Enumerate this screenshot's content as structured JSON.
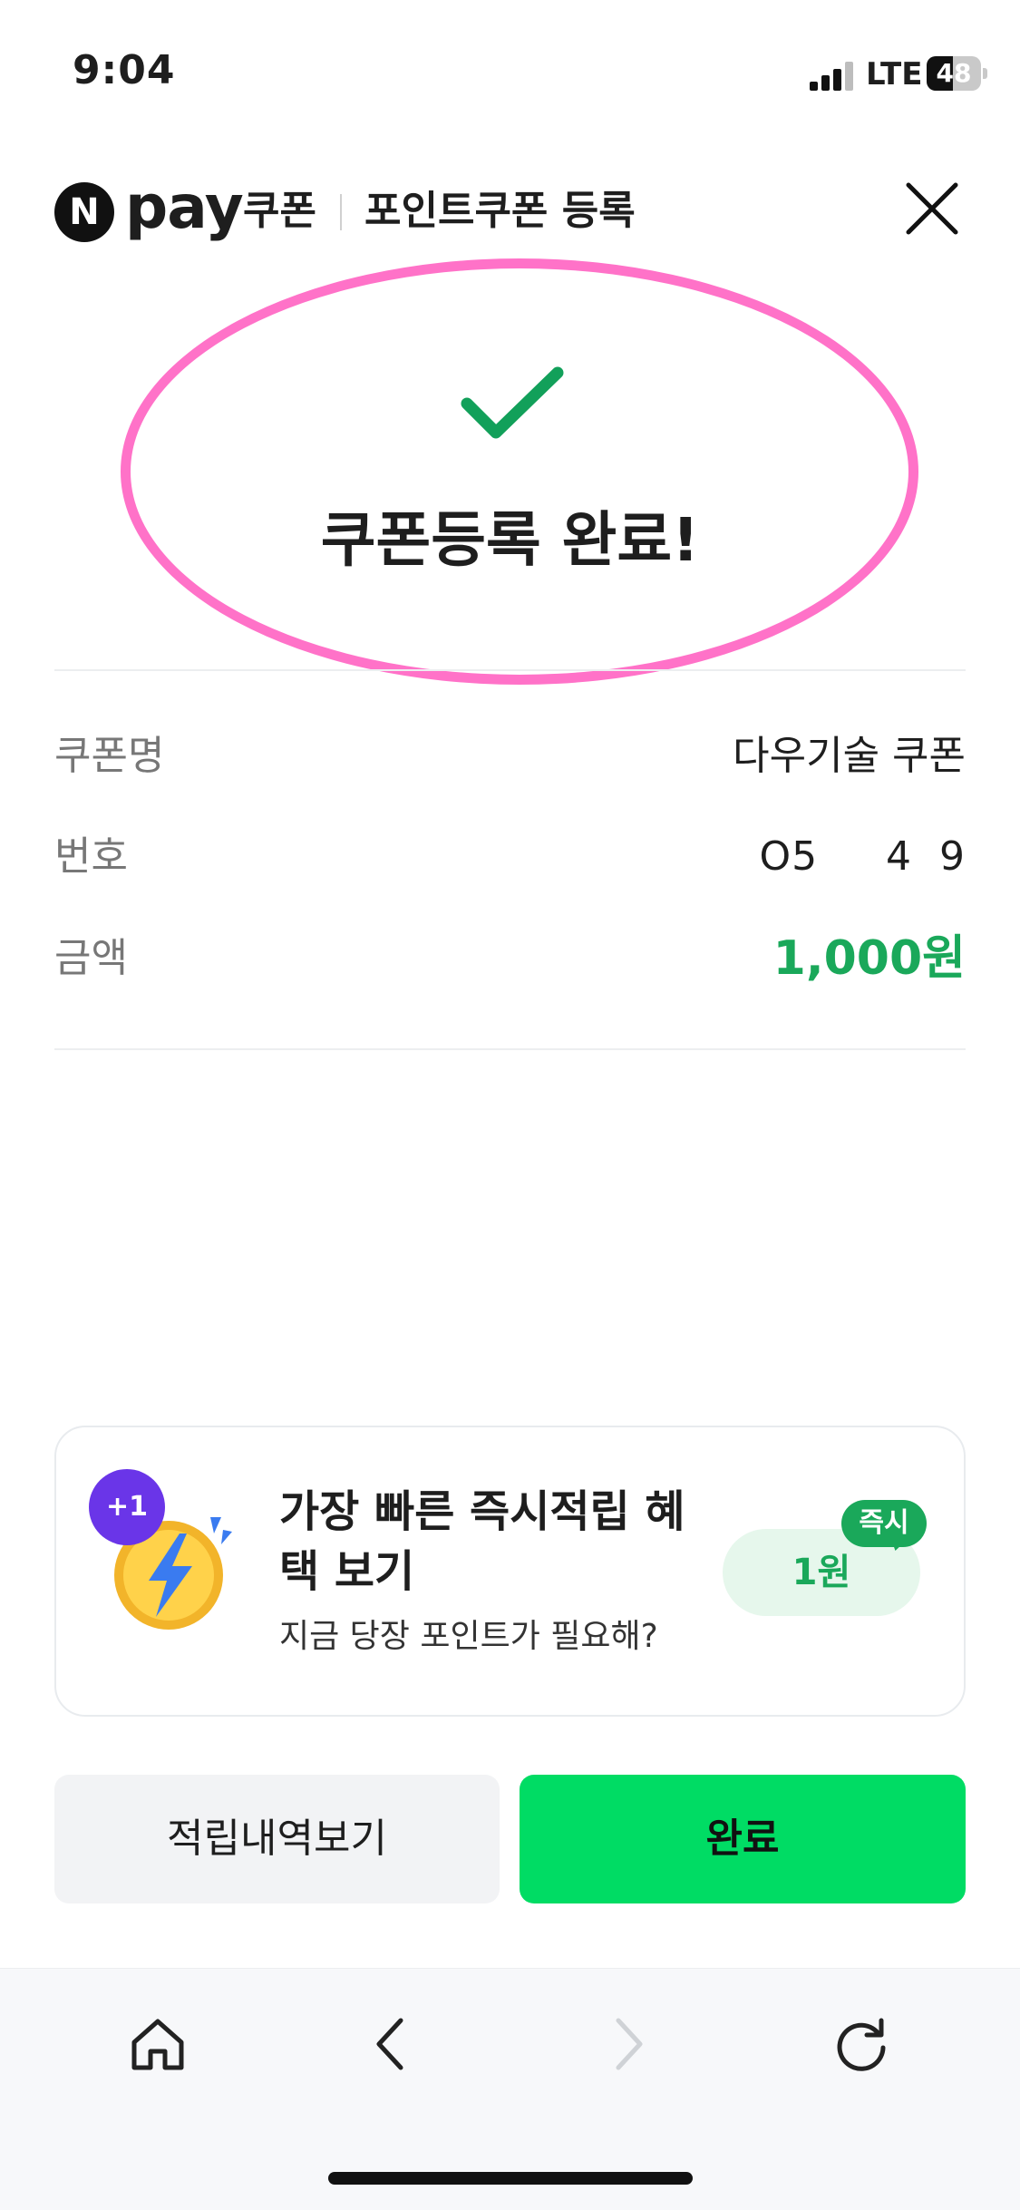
{
  "status_bar": {
    "time": "9:04",
    "network": "LTE",
    "battery": "48",
    "battery_level": 0.48
  },
  "header": {
    "logo_letter": "N",
    "brand": "pay",
    "service": "쿠폰",
    "title": "포인트쿠폰 등록"
  },
  "result": {
    "title": "쿠폰등록 완료!"
  },
  "details": {
    "name_label": "쿠폰명",
    "name_value": "다우기술 쿠폰",
    "number_label": "번호",
    "number_value": "O5     4  9",
    "amount_label": "금액",
    "amount_value": "1,000원"
  },
  "promo": {
    "plus_badge": "+1",
    "title": "가장 빠른 즉시적립 혜택 보기",
    "subtitle": "지금 당장 포인트가 필요해?",
    "amount": "1원",
    "badge": "즉시"
  },
  "buttons": {
    "history": "적립내역보기",
    "done": "완료"
  },
  "colors": {
    "accent_green": "#00dc64",
    "amount_green": "#1aa85a",
    "highlight_pink": "#ff72c8",
    "promo_purple": "#6a35e8"
  },
  "icons": [
    "signal-icon",
    "battery-icon",
    "close-icon",
    "check-icon",
    "coin-icon",
    "home-icon",
    "back-icon",
    "forward-icon",
    "reload-icon"
  ]
}
